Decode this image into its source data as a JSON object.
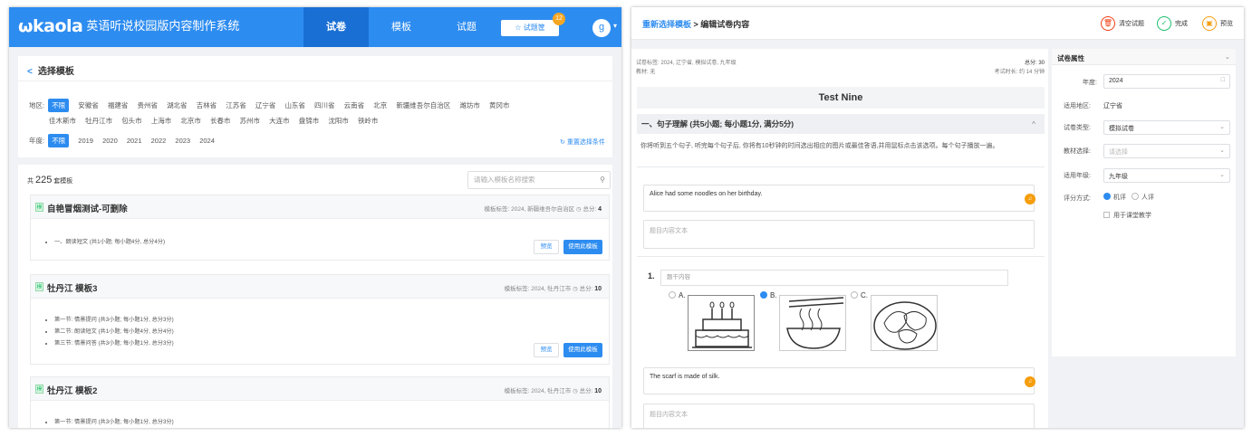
{
  "left": {
    "brand": "ωkaola",
    "system_name": "英语听说校园版内容制作系统",
    "nav": [
      "试卷",
      "模板",
      "试题"
    ],
    "tikuan_label": "☆ 试题筐",
    "tikuan_count": "12",
    "avatar_letter": "g",
    "select_title": "选择模板",
    "region_label": "地区:",
    "region_options": [
      "不限",
      "安徽省",
      "福建省",
      "贵州省",
      "湖北省",
      "吉林省",
      "江苏省",
      "辽宁省",
      "山东省",
      "四川省",
      "云南省",
      "北京",
      "新疆维吾尔自治区",
      "潍坊市",
      "黄冈市"
    ],
    "region_options_2": [
      "佳木斯市",
      "牡丹江市",
      "包头市",
      "上海市",
      "北京市",
      "长春市",
      "苏州市",
      "大连市",
      "盘锦市",
      "沈阳市",
      "铁岭市"
    ],
    "year_label": "年度:",
    "year_options": [
      "不限",
      "2019",
      "2020",
      "2021",
      "2022",
      "2023",
      "2024"
    ],
    "reset_label": "重置选择条件",
    "count_prefix": "共",
    "count_num": "225",
    "count_suffix": "套模板",
    "search_placeholder": "请输入模板名称搜索",
    "templates": [
      {
        "badge": "模",
        "name": "自艳冒烟测试-可删除",
        "tags": "模板标签: 2024, 新疆维吾尔自治区",
        "total_label": "总分:",
        "total": "4",
        "items": [
          "一、朗读短文 (共1小题; 每小题4分, 总分4分)"
        ]
      },
      {
        "badge": "模",
        "name": "牡丹江 模板3",
        "tags": "模板标签: 2024, 牡丹江市",
        "total_label": "总分:",
        "total": "10",
        "items": [
          "第一节: 情景提问 (共3小题; 每小题1分, 总分3分)",
          "第二节: 朗读短文 (共1小题; 每小题4分, 总分4分)",
          "第三节: 情景问答 (共3小题; 每小题1分, 总分3分)"
        ]
      },
      {
        "badge": "模",
        "name": "牡丹江 模板2",
        "tags": "模板标签: 2024, 牡丹江市",
        "total_label": "总分:",
        "total": "10",
        "items": [
          "第一节: 情景提问 (共3小题; 每小题1分, 总分3分)"
        ]
      }
    ],
    "preview_label": "预览",
    "use_label": "使用此模板"
  },
  "right": {
    "crumb_link": "重新选择模板",
    "crumb_rest": " > 编辑试卷内容",
    "actions": [
      "清空试题",
      "完成",
      "预览"
    ],
    "tags_line": "试卷标签: 2024, 辽宁省, 模拟试卷, 九年级",
    "textbook_line": "教材: 无",
    "total_line": "总分: 30",
    "duration_line": "考试时长: 约 14 分钟",
    "paper_title": "Test Nine",
    "section_title": "一、句子理解 (共5小题; 每小题1分, 满分5分)",
    "instruction": "你将听到五个句子, 听完每个句子后, 你将有10秒钟的时间选出相应的图片或最佳答语,并用鼠标点击该选项。每个句子播放一遍。",
    "q1_text": "Alice had some noodles on her birthday.",
    "content_placeholder": "题目内容文本",
    "q_number": "1.",
    "stem_placeholder": "题干内容",
    "options": [
      "A.",
      "B.",
      "C."
    ],
    "q2_text": "The scarf is made of silk.",
    "props_title": "试卷属性",
    "form": {
      "year_label": "年度:",
      "year_value": "2024",
      "region_label": "适用地区:",
      "region_value": "辽宁省",
      "type_label": "试卷类型:",
      "type_value": "模拟试卷",
      "textbook_label": "教材选择:",
      "textbook_placeholder": "请选择",
      "grade_label": "适用年级:",
      "grade_value": "九年级",
      "scoring_label": "评分方式:",
      "scoring_machine": "机评",
      "scoring_human": "人评",
      "classroom_label": "用于课堂教学"
    }
  }
}
